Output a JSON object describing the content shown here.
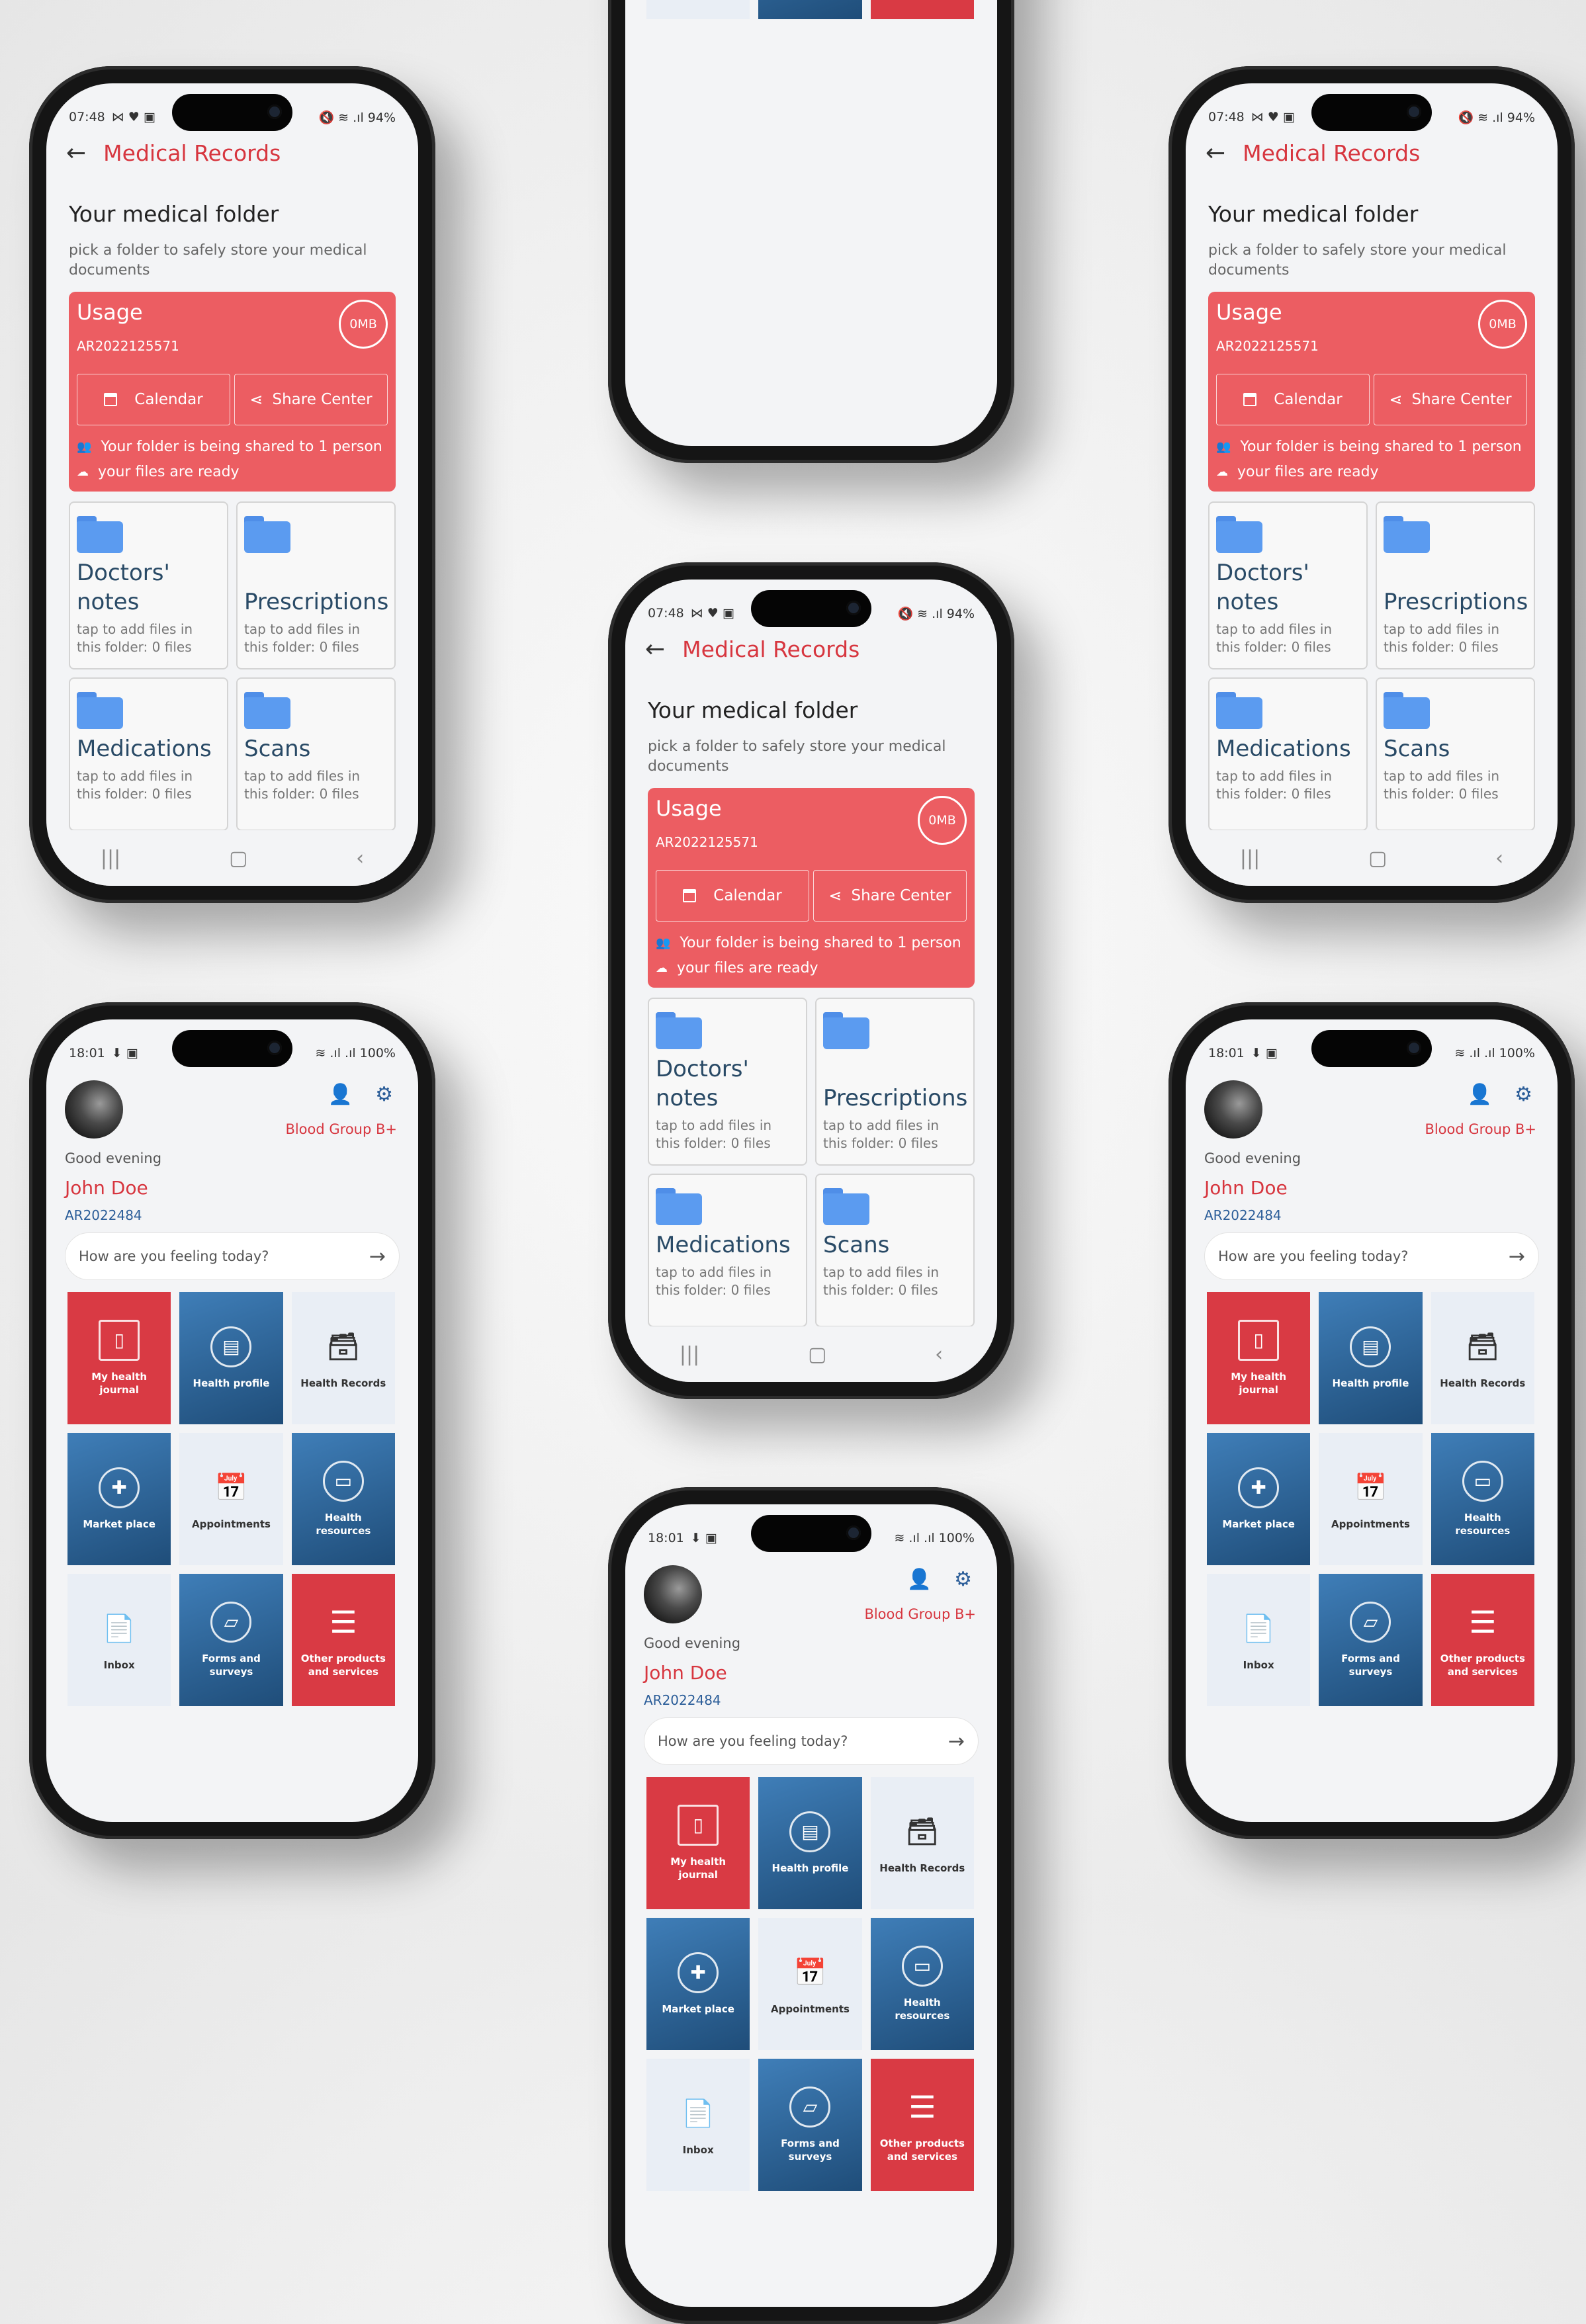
{
  "status_records": {
    "time": "07:48",
    "left_icons": "⋈ ♥ ▣",
    "right": "🔇 ≋ .ıl 94%"
  },
  "status_home": {
    "time": "18:01",
    "left_icons": "⬇ ▣",
    "right": "≋ .ıl .ıl 100%"
  },
  "records": {
    "title": "Medical Records",
    "heading": "Your medical folder",
    "subtitle": "pick a folder to safely store your medical documents",
    "usage_label": "Usage",
    "usage_id": "AR2022125571",
    "usage_size": "0MB",
    "calendar_label": "Calendar",
    "share_label": "Share Center",
    "shared_text": "Your folder is being shared to 1 person",
    "ready_text": "your files are ready",
    "folders": [
      {
        "name": "Doctors' notes",
        "hint": "tap to add files in this folder: 0 files"
      },
      {
        "name": "Prescriptions",
        "hint": "tap to add files in this folder: 0 files"
      },
      {
        "name": "Medications",
        "hint": "tap to add files in this folder: 0 files"
      },
      {
        "name": "Scans",
        "hint": "tap to add files in this folder: 0 files"
      }
    ]
  },
  "home": {
    "blood_group": "Blood Group B+",
    "greeting": "Good evening",
    "name": "John Doe",
    "id": "AR2022484",
    "mood_placeholder": "How are you feeling today?",
    "tiles": [
      {
        "label": "My health journal",
        "icon": "notebook-icon",
        "glyph": "▯",
        "style": "red"
      },
      {
        "label": "Health profile",
        "icon": "profile-icon",
        "glyph": "▤",
        "style": "blue"
      },
      {
        "label": "Health Records",
        "icon": "archive-icon",
        "glyph": "🗃",
        "style": "light"
      },
      {
        "label": "Market place",
        "icon": "hands-heart-icon",
        "glyph": "✚",
        "style": "blue"
      },
      {
        "label": "Appointments",
        "icon": "calendar-icon",
        "glyph": "📅",
        "style": "light"
      },
      {
        "label": "Health resources",
        "icon": "resources-icon",
        "glyph": "▭",
        "style": "blue"
      },
      {
        "label": "Inbox",
        "icon": "inbox-icon",
        "glyph": "📄",
        "style": "light"
      },
      {
        "label": "Forms and surveys",
        "icon": "forms-icon",
        "glyph": "▱",
        "style": "blue"
      },
      {
        "label": "Other products and services",
        "icon": "list-icon",
        "glyph": "☰",
        "style": "red"
      }
    ]
  }
}
